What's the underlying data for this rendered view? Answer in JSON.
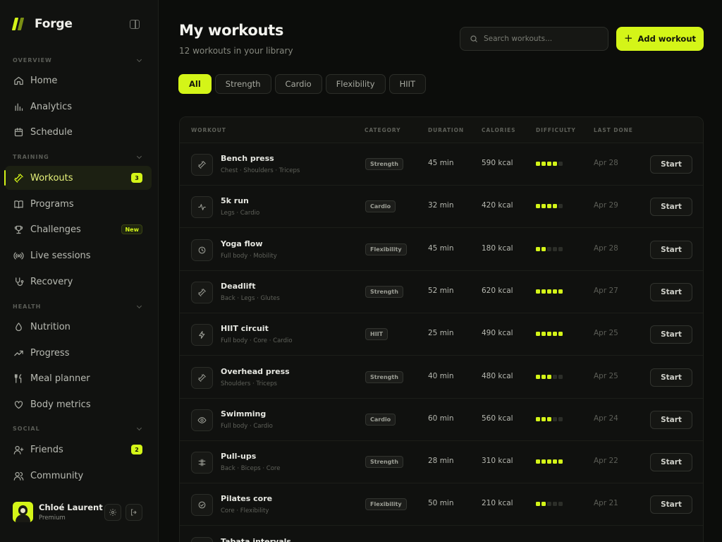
{
  "brand": {
    "name": "Forge"
  },
  "sidebar": {
    "sections": {
      "overview": "OVERVIEW",
      "training": "TRAINING",
      "health": "HEALTH",
      "social": "SOCIAL"
    },
    "items": [
      {
        "label": "Home",
        "icon": "home-icon"
      },
      {
        "label": "Analytics",
        "icon": "bar-chart-icon"
      },
      {
        "label": "Schedule",
        "icon": "calendar-icon"
      },
      {
        "label": "Workouts",
        "icon": "dumbbell-icon",
        "badge": "3",
        "active": true
      },
      {
        "label": "Programs",
        "icon": "book-icon"
      },
      {
        "label": "Challenges",
        "icon": "trophy-icon",
        "badge": "New"
      },
      {
        "label": "Live sessions",
        "icon": "broadcast-icon"
      },
      {
        "label": "Recovery",
        "icon": "stethoscope-icon"
      },
      {
        "label": "Nutrition",
        "icon": "drop-icon"
      },
      {
        "label": "Progress",
        "icon": "trend-icon"
      },
      {
        "label": "Meal planner",
        "icon": "utensils-icon"
      },
      {
        "label": "Body metrics",
        "icon": "heart-icon"
      },
      {
        "label": "Friends",
        "icon": "user-plus-icon",
        "badge": "2"
      },
      {
        "label": "Community",
        "icon": "users-icon"
      }
    ]
  },
  "profile": {
    "name": "Chloé Laurent",
    "plan": "Premium"
  },
  "header": {
    "title": "My workouts",
    "subtitle": "12 workouts in your library",
    "search_placeholder": "Search workouts...",
    "add_label": "Add workout"
  },
  "filters": [
    "All",
    "Strength",
    "Cardio",
    "Flexibility",
    "HIIT"
  ],
  "table": {
    "columns": {
      "workout": "WORKOUT",
      "category": "CATEGORY",
      "duration": "DURATION",
      "calories": "CALORIES",
      "difficulty": "DIFFICULTY",
      "last_done": "LAST DONE"
    },
    "start_label": "Start",
    "rows": [
      {
        "name": "Bench press",
        "muscles": "Chest · Shoulders · Triceps",
        "category": "Strength",
        "duration": "45 min",
        "calories": "590 kcal",
        "difficulty": 4,
        "last_done": "Apr 28",
        "icon": "dumbbell-icon"
      },
      {
        "name": "5k run",
        "muscles": "Legs · Cardio",
        "category": "Cardio",
        "duration": "32 min",
        "calories": "420 kcal",
        "difficulty": 4,
        "last_done": "Apr 29",
        "icon": "pulse-icon"
      },
      {
        "name": "Yoga flow",
        "muscles": "Full body · Mobility",
        "category": "Flexibility",
        "duration": "45 min",
        "calories": "180 kcal",
        "difficulty": 2,
        "last_done": "Apr 28",
        "icon": "clock-icon"
      },
      {
        "name": "Deadlift",
        "muscles": "Back · Legs · Glutes",
        "category": "Strength",
        "duration": "52 min",
        "calories": "620 kcal",
        "difficulty": 5,
        "last_done": "Apr 27",
        "icon": "dumbbell-icon"
      },
      {
        "name": "HIIT circuit",
        "muscles": "Full body · Core · Cardio",
        "category": "HIIT",
        "duration": "25 min",
        "calories": "490 kcal",
        "difficulty": 5,
        "last_done": "Apr 25",
        "icon": "bolt-icon"
      },
      {
        "name": "Overhead press",
        "muscles": "Shoulders · Triceps",
        "category": "Strength",
        "duration": "40 min",
        "calories": "480 kcal",
        "difficulty": 3,
        "last_done": "Apr 25",
        "icon": "dumbbell-icon"
      },
      {
        "name": "Swimming",
        "muscles": "Full body · Cardio",
        "category": "Cardio",
        "duration": "60 min",
        "calories": "560 kcal",
        "difficulty": 3,
        "last_done": "Apr 24",
        "icon": "eye-icon"
      },
      {
        "name": "Pull-ups",
        "muscles": "Back · Biceps · Core",
        "category": "Strength",
        "duration": "28 min",
        "calories": "310 kcal",
        "difficulty": 5,
        "last_done": "Apr 22",
        "icon": "bar-icon"
      },
      {
        "name": "Pilates core",
        "muscles": "Core · Flexibility",
        "category": "Flexibility",
        "duration": "50 min",
        "calories": "210 kcal",
        "difficulty": 2,
        "last_done": "Apr 21",
        "icon": "check-circle-icon"
      },
      {
        "name": "Tabata intervals",
        "muscles": "",
        "category": "",
        "duration": "",
        "calories": "",
        "difficulty": 0,
        "last_done": "",
        "icon": "bolt-icon"
      }
    ]
  },
  "colors": {
    "accent": "#d4f518",
    "background": "#0c0d0b",
    "sidebar": "#111210"
  }
}
